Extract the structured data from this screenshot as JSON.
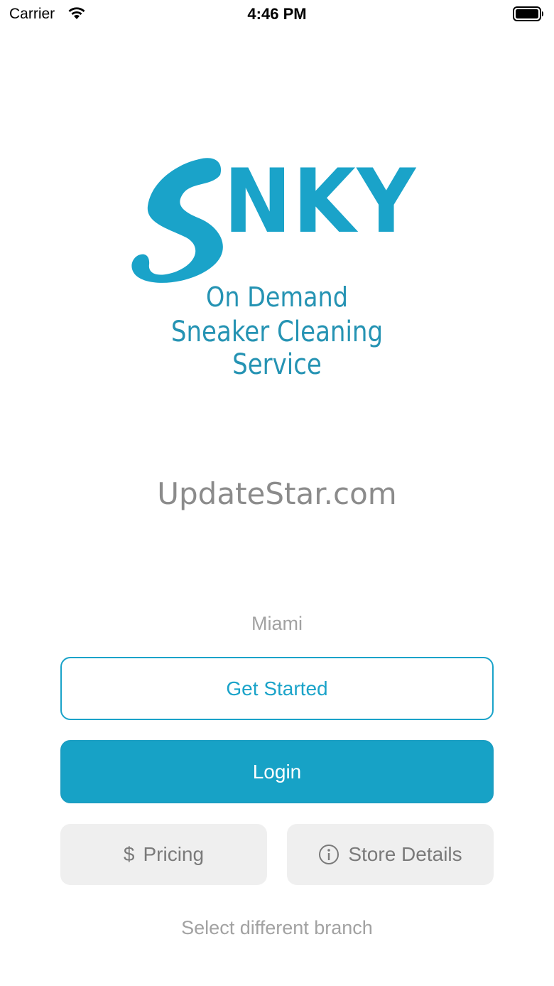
{
  "status_bar": {
    "carrier": "Carrier",
    "time": "4:46 PM",
    "wifi_icon": "wifi-icon",
    "battery_icon": "battery-full-icon"
  },
  "logo": {
    "brand": "SNKY",
    "brand_rest": "NKY",
    "tagline_line1": "On Demand",
    "tagline_line2": "Sneaker Cleaning Service",
    "color": "#1aa3c9"
  },
  "watermark": "UpdateStar.com",
  "branch": {
    "name": "Miami"
  },
  "actions": {
    "get_started": "Get Started",
    "login": "Login",
    "pricing": "Pricing",
    "pricing_icon": "dollar-icon",
    "store_details": "Store Details",
    "store_details_icon": "info-circle-icon",
    "select_branch": "Select different branch"
  },
  "colors": {
    "accent": "#17a2c6",
    "secondary_bg": "#efefef",
    "muted_text": "#a2a2a2"
  }
}
